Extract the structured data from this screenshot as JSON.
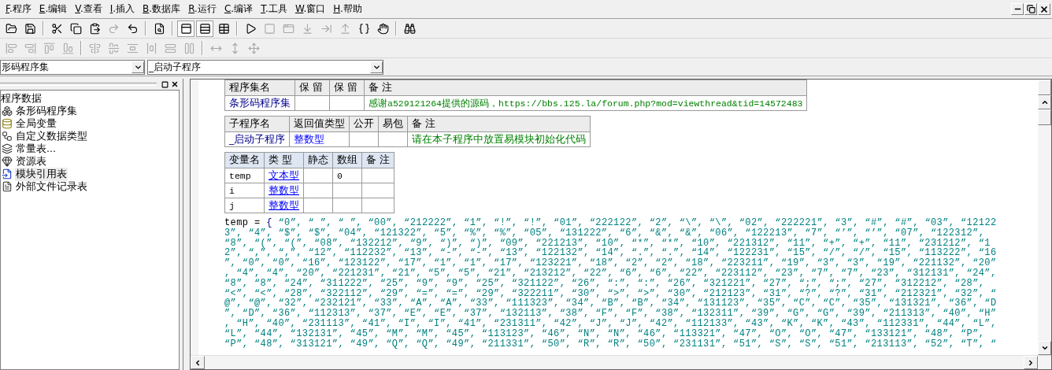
{
  "menu": [
    {
      "accel": "F",
      "label": ".程序"
    },
    {
      "accel": "E",
      "label": ".编辑"
    },
    {
      "accel": "V",
      "label": ".查看"
    },
    {
      "accel": "I",
      "label": ".插入"
    },
    {
      "accel": "B",
      "label": ".数据库"
    },
    {
      "accel": "R",
      "label": ".运行"
    },
    {
      "accel": "C",
      "label": ".编译"
    },
    {
      "accel": "T",
      "label": ".工具"
    },
    {
      "accel": "W",
      "label": ".窗口"
    },
    {
      "accel": "H",
      "label": ".帮助"
    }
  ],
  "toolbars": [
    {
      "items": [
        {
          "kind": "open",
          "disabled": false,
          "pressed": false
        },
        {
          "kind": "save",
          "disabled": false,
          "pressed": false
        },
        {
          "kind": "separator"
        },
        {
          "kind": "cut",
          "disabled": false,
          "pressed": false
        },
        {
          "kind": "copy",
          "disabled": false,
          "pressed": false
        },
        {
          "kind": "paste",
          "disabled": false,
          "pressed": false
        },
        {
          "kind": "redo",
          "disabled": true,
          "pressed": false
        },
        {
          "kind": "undo",
          "disabled": false,
          "pressed": false
        },
        {
          "kind": "separator"
        },
        {
          "kind": "find",
          "disabled": false,
          "pressed": false
        },
        {
          "kind": "separator"
        },
        {
          "kind": "layout-top",
          "disabled": false,
          "pressed": true
        },
        {
          "kind": "layout-split",
          "disabled": false,
          "pressed": true
        },
        {
          "kind": "layout-table",
          "disabled": false,
          "pressed": false
        },
        {
          "kind": "separator"
        },
        {
          "kind": "run",
          "disabled": false,
          "pressed": false
        },
        {
          "kind": "stop",
          "disabled": true,
          "pressed": false
        },
        {
          "kind": "window",
          "disabled": true,
          "pressed": false
        },
        {
          "kind": "step-into",
          "disabled": true,
          "pressed": false
        },
        {
          "kind": "step-over",
          "disabled": true,
          "pressed": false
        },
        {
          "kind": "step-out",
          "disabled": true,
          "pressed": false
        },
        {
          "kind": "run-to",
          "disabled": false,
          "pressed": false
        },
        {
          "kind": "hand",
          "disabled": false,
          "pressed": false
        },
        {
          "kind": "separator"
        },
        {
          "kind": "binoculars",
          "disabled": false,
          "pressed": false
        }
      ]
    },
    {
      "items": [
        {
          "kind": "align-left",
          "disabled": true,
          "pressed": false
        },
        {
          "kind": "align-right",
          "disabled": true,
          "pressed": false
        },
        {
          "kind": "align-top",
          "disabled": true,
          "pressed": false
        },
        {
          "kind": "align-bottom",
          "disabled": true,
          "pressed": false
        },
        {
          "kind": "separator"
        },
        {
          "kind": "center-h",
          "disabled": true,
          "pressed": false
        },
        {
          "kind": "center-v",
          "disabled": true,
          "pressed": false
        },
        {
          "kind": "space-v",
          "disabled": true,
          "pressed": false
        },
        {
          "kind": "space-h",
          "disabled": true,
          "pressed": false
        },
        {
          "kind": "spread-h",
          "disabled": true,
          "pressed": false
        },
        {
          "kind": "spread-v",
          "disabled": true,
          "pressed": false
        },
        {
          "kind": "separator"
        },
        {
          "kind": "width",
          "disabled": true,
          "pressed": false
        },
        {
          "kind": "height",
          "disabled": true,
          "pressed": false
        },
        {
          "kind": "size",
          "disabled": true,
          "pressed": false
        }
      ]
    }
  ],
  "selectors": [
    {
      "value": "形码程序集"
    },
    {
      "value": "_启动子程序"
    }
  ],
  "tree": {
    "label": "程序数据",
    "children": [
      {
        "kind": "assembly",
        "label": "条形码程序集",
        "selected": false
      },
      {
        "kind": "global",
        "label": "全局变量",
        "selected": false
      },
      {
        "kind": "datatype",
        "label": "自定义数据类型",
        "selected": false
      },
      {
        "kind": "constant",
        "label": "常量表...",
        "selected": false
      },
      {
        "kind": "resource",
        "label": "资源表",
        "selected": false
      },
      {
        "kind": "module",
        "label": "模块引用表",
        "selected": true
      },
      {
        "kind": "file",
        "label": "外部文件记录表",
        "selected": false
      }
    ]
  },
  "assembly_table": {
    "columns": [
      "程序集名",
      "保 留",
      "保 留",
      "备 注"
    ],
    "rows": [
      {
        "name": "条形码程序集",
        "comment": "感谢a529121264提供的源码，https://bbs.125.la/forum.php?mod=viewthread&tid=14572483"
      }
    ]
  },
  "sub_table": {
    "columns": [
      "子程序名",
      "返回值类型",
      "公开",
      "易包",
      "备 注"
    ],
    "rows": [
      {
        "name": "_启动子程序",
        "return_type": "整数型",
        "comment": "请在本子程序中放置易模块初始化代码"
      }
    ]
  },
  "var_table": {
    "columns": [
      "变量名",
      "类 型",
      "静态",
      "数组",
      "备 注"
    ],
    "rows": [
      {
        "name": "temp",
        "type": "文本型",
        "array": "0"
      },
      {
        "name": "i",
        "type": "整数型"
      },
      {
        "name": "j",
        "type": "整数型"
      }
    ]
  },
  "code": {
    "variable": "temp",
    "operator": "=",
    "open_brace": "{",
    "lines": [
      "“0”, “ ”, “ ”, “00”, “212222”, “1”, “!”, “!”, “01”, “222122”, “2”, “\\”, “\\”, “02”, “222221”, “3”, “#”, “#”, “03”, “12122",
      "3”, “4”, “$”, “$”, “04”, “121322”, “5”, “%”, “%”, “05”, “131222”, “6”, “&”, “&”, “06”, “122213”, “7”, “’”, “’”, “07”, “122312”,",
      "“8”, “(”, “(”, “08”, “132212”, “9”, “)”, “)”, “09”, “221213”, “10”, “*”, “*”, “10”, “221312”, “11”, “+”, “+”, “11”, “231212”, “1",
      "2”, “,”, “,”, “12”, “112232”, “13”, “-”, “-”, “13”, “122132”, “14”, “.”, “.”, “14”, “122231”, “15”, “/”, “/”, “15”, “113222”, “16",
      "”, “0”, “0”, “16”, “123122”, “17”, “1”, “1”, “17”, “123221”, “18”, “2”, “2”, “18”, “223211”, “19”, “3”, “3”, “19”, “221132”, “20”",
      ", “4”, “4”, “20”, “221231”, “21”, “5”, “5”, “21”, “213212”, “22”, “6”, “6”, “22”, “223112”, “23”, “7”, “7”, “23”, “312131”, “24”,",
      "“8”, “8”, “24”, “311222”, “25”, “9”, “9”, “25”, “321122”, “26”, “:”, “:”, “26”, “321221”, “27”, “;”, “;”, “27”, “312212”, “28”,",
      "“<”, “<”, “28”, “322112”, “29”, “=”, “=”, “29”, “322211”, “30”, “>”, “>”, “30”, “212123”, “31”, “?”, “?”, “31”, “212321”, “32”, “",
      "@”, “@”, “32”, “232121”, “33”, “A”, “A”, “33”, “111323”, “34”, “B”, “B”, “34”, “131123”, “35”, “C”, “C”, “35”, “131321”, “36”, “D",
      "”, “D”, “36”, “112313”, “37”, “E”, “E”, “37”, “132113”, “38”, “F”, “F”, “38”, “132311”, “39”, “G”, “G”, “39”, “211313”, “40”, “H”",
      ", “H”, “40”, “231113”, “41”, “I”, “I”, “41”, “231311”, “42”, “J”, “J”, “42”, “112133”, “43”, “K”, “K”, “43”, “112331”, “44”, “L”,",
      "“L”, “44”, “132131”, “45”, “M”, “M”, “45”, “113123”, “46”, “N”, “N”, “46”, “113321”, “47”, “O”, “O”, “47”, “133121”, “48”, “P”,",
      "“P”, “48”, “313121”, “49”, “Q”, “Q”, “49”, “211331”, “50”, “R”, “R”, “50”, “231131”, “51”, “S”, “S”, “51”, “213113”, “52”, “T”, “"
    ]
  }
}
